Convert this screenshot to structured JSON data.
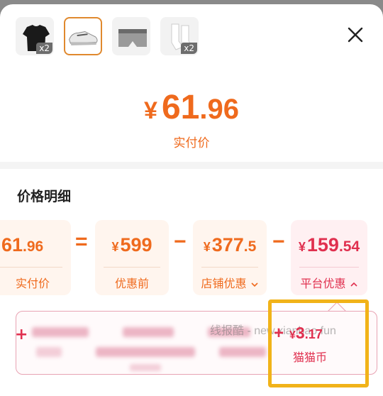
{
  "products": [
    {
      "name": "tshirt-thumbnail",
      "qty": "x2"
    },
    {
      "name": "sneaker-thumbnail",
      "qty": ""
    },
    {
      "name": "underwear-thumbnail",
      "qty": ""
    },
    {
      "name": "socks-thumbnail",
      "qty": "x2"
    }
  ],
  "price": {
    "currency": "¥",
    "integer": "61",
    "decimal": ".96",
    "label": "实付价"
  },
  "breakdown": {
    "title": "价格明细",
    "items": [
      {
        "currency": "¥",
        "integer": "61",
        "decimal": ".96",
        "label": "实付价"
      },
      {
        "currency": "¥",
        "integer": "599",
        "decimal": "",
        "label": "优惠前"
      },
      {
        "currency": "¥",
        "integer": "377",
        "decimal": ".5",
        "label": "店铺优惠",
        "chevron": "chevron-down-icon"
      },
      {
        "currency": "¥",
        "integer": "159",
        "decimal": ".54",
        "label": "平台优惠",
        "chevron": "chevron-up-icon"
      }
    ],
    "operators": [
      "=",
      "−",
      "−"
    ]
  },
  "platform_detail": {
    "coin_sign": "+",
    "coin_currency": "¥",
    "coin_integer": "3",
    "coin_decimal": ".17",
    "coin_label": "猫猫币"
  },
  "watermark": "线报酷 - new.xianbao.fun",
  "colors": {
    "accent": "#ef6a1d",
    "platform": "#e0304f",
    "highlight": "#f1b319"
  }
}
